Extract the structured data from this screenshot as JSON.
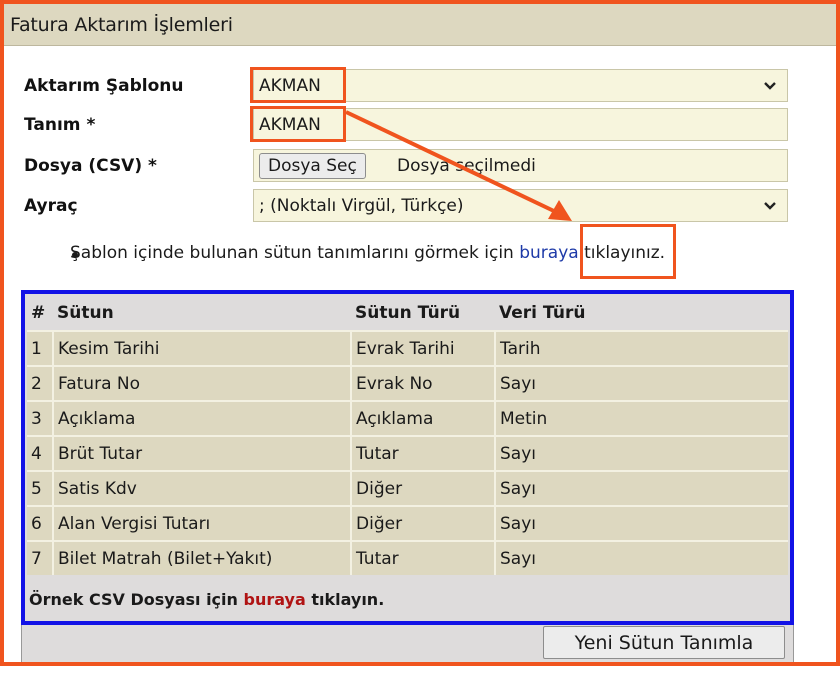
{
  "panel": {
    "title": "Fatura Aktarım İşlemleri"
  },
  "form": {
    "template_label": "Aktarım Şablonu",
    "template_value": "AKMAN",
    "name_label": "Tanım *",
    "name_value": "AKMAN",
    "file_label": "Dosya (CSV) *",
    "file_button": "Dosya Seç",
    "file_status": "Dosya seçilmedi",
    "separator_label": "Ayraç",
    "separator_value": "; (Noktalı Virgül, Türkçe)"
  },
  "info": {
    "before_link": "Şablon içinde bulunan sütun tanımlarını görmek için ",
    "link": "buraya",
    "after_link": " tıklayınız."
  },
  "columns_table": {
    "headers": [
      "#",
      "Sütun",
      "Sütun Türü",
      "Veri Türü"
    ],
    "rows": [
      [
        "1",
        "Kesim Tarihi",
        "Evrak Tarihi",
        "Tarih"
      ],
      [
        "2",
        "Fatura No",
        "Evrak No",
        "Sayı"
      ],
      [
        "3",
        "Açıklama",
        "Açıklama",
        "Metin"
      ],
      [
        "4",
        "Brüt Tutar",
        "Tutar",
        "Sayı"
      ],
      [
        "5",
        "Satis Kdv",
        "Diğer",
        "Sayı"
      ],
      [
        "6",
        "Alan Vergisi Tutarı",
        "Diğer",
        "Sayı"
      ],
      [
        "7",
        "Bilet Matrah (Bilet+Yakıt)",
        "Tutar",
        "Sayı"
      ]
    ]
  },
  "sample": {
    "before_link": "Örnek CSV Dosyası için ",
    "link": "buraya",
    "after_link": " tıklayın."
  },
  "actions": {
    "new_column": "Yeni Sütun Tanımla"
  },
  "colors": {
    "annotation_red": "#f0541e",
    "annotation_blue": "#1212e6",
    "link_blue": "#1e3aa8",
    "link_red": "#b01313",
    "field_bg": "#f7f5dd",
    "header_bg": "#ddd8c0"
  }
}
